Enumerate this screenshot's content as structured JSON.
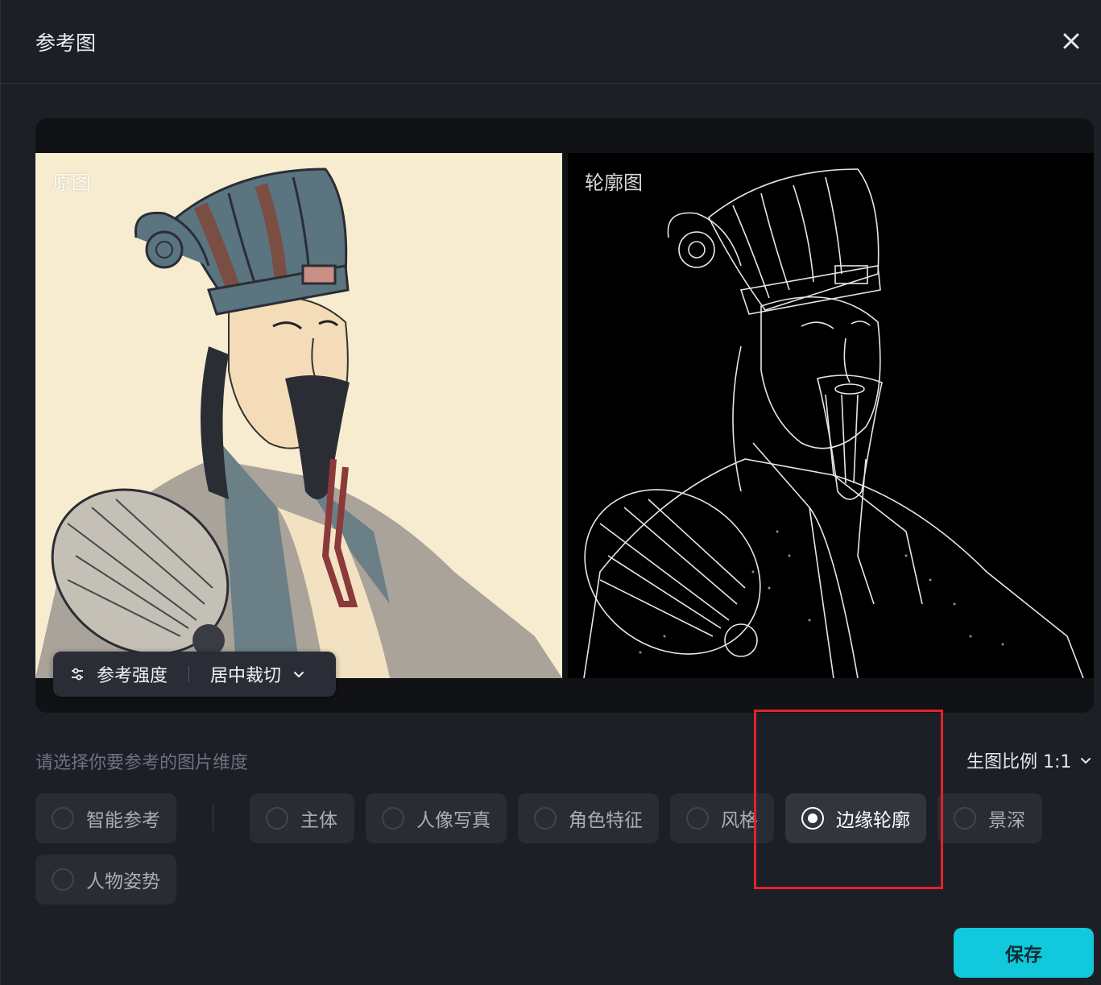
{
  "dialog": {
    "title": "参考图"
  },
  "preview": {
    "original_label": "原图",
    "outline_label": "轮廓图",
    "strength_label": "参考强度",
    "crop_label": "居中裁切"
  },
  "settings": {
    "hint": "请选择你要参考的图片维度",
    "ratio_label": "生图比例 1:1"
  },
  "options": [
    {
      "label": "智能参考",
      "selected": false
    },
    {
      "label": "主体",
      "selected": false
    },
    {
      "label": "人像写真",
      "selected": false
    },
    {
      "label": "角色特征",
      "selected": false
    },
    {
      "label": "风格",
      "selected": false
    },
    {
      "label": "边缘轮廓",
      "selected": true
    },
    {
      "label": "景深",
      "selected": false
    },
    {
      "label": "人物姿势",
      "selected": false
    }
  ],
  "actions": {
    "save_label": "保存"
  },
  "colors": {
    "accent": "#12c8dc",
    "highlight": "#e3222a",
    "background": "#1d1f26"
  }
}
